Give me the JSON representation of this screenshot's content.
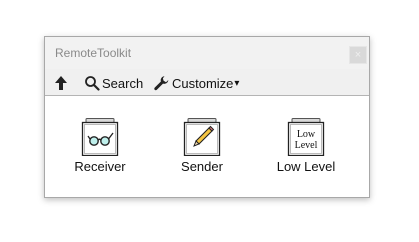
{
  "window": {
    "title": "RemoteToolkit",
    "close_glyph": "×"
  },
  "toolbar": {
    "up_icon": "arrow-up-icon",
    "search_label": "Search",
    "customize_label": "Customize",
    "customize_arrow": "▾"
  },
  "tools": [
    {
      "label": "Receiver",
      "icon": "glasses-icon"
    },
    {
      "label": "Sender",
      "icon": "pencil-icon"
    },
    {
      "label": "Low Level",
      "icon": "low-level-icon",
      "icon_text_line1": "Low",
      "icon_text_line2": "Level"
    }
  ]
}
